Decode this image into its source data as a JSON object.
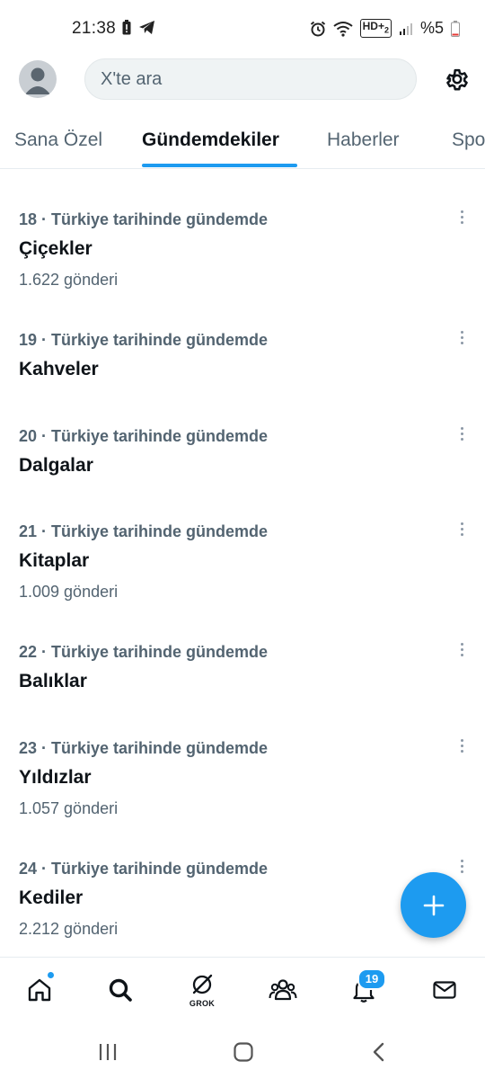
{
  "status_bar": {
    "time": "21:38",
    "battery": "%5",
    "network_label": "HD+",
    "sim_index": "2"
  },
  "search": {
    "placeholder": "X'te ara"
  },
  "tabs": [
    {
      "label": "Sana Özel",
      "active": false
    },
    {
      "label": "Gündemdekiler",
      "active": true
    },
    {
      "label": "Haberler",
      "active": false
    },
    {
      "label": "Spor",
      "active": false
    }
  ],
  "trends": [
    {
      "meta": "18 · Türkiye tarihinde gündemde",
      "title": "Çiçekler",
      "count": "1.622 gönderi"
    },
    {
      "meta": "19 · Türkiye tarihinde gündemde",
      "title": "Kahveler",
      "count": ""
    },
    {
      "meta": "20 · Türkiye tarihinde gündemde",
      "title": "Dalgalar",
      "count": ""
    },
    {
      "meta": "21 · Türkiye tarihinde gündemde",
      "title": "Kitaplar",
      "count": "1.009 gönderi"
    },
    {
      "meta": "22 · Türkiye tarihinde gündemde",
      "title": "Balıklar",
      "count": ""
    },
    {
      "meta": "23 · Türkiye tarihinde gündemde",
      "title": "Yıldızlar",
      "count": "1.057 gönderi"
    },
    {
      "meta": "24 · Türkiye tarihinde gündemde",
      "title": "Kediler",
      "count": "2.212 gönderi"
    }
  ],
  "bottom_nav": {
    "grok_label": "GROK",
    "notifications_badge": "19",
    "icons": [
      "home-icon",
      "search-icon",
      "grok-icon",
      "communities-icon",
      "notifications-icon",
      "messages-icon"
    ]
  },
  "colors": {
    "accent": "#1d9bf0",
    "text_primary": "#0f1419",
    "text_secondary": "#536471"
  }
}
